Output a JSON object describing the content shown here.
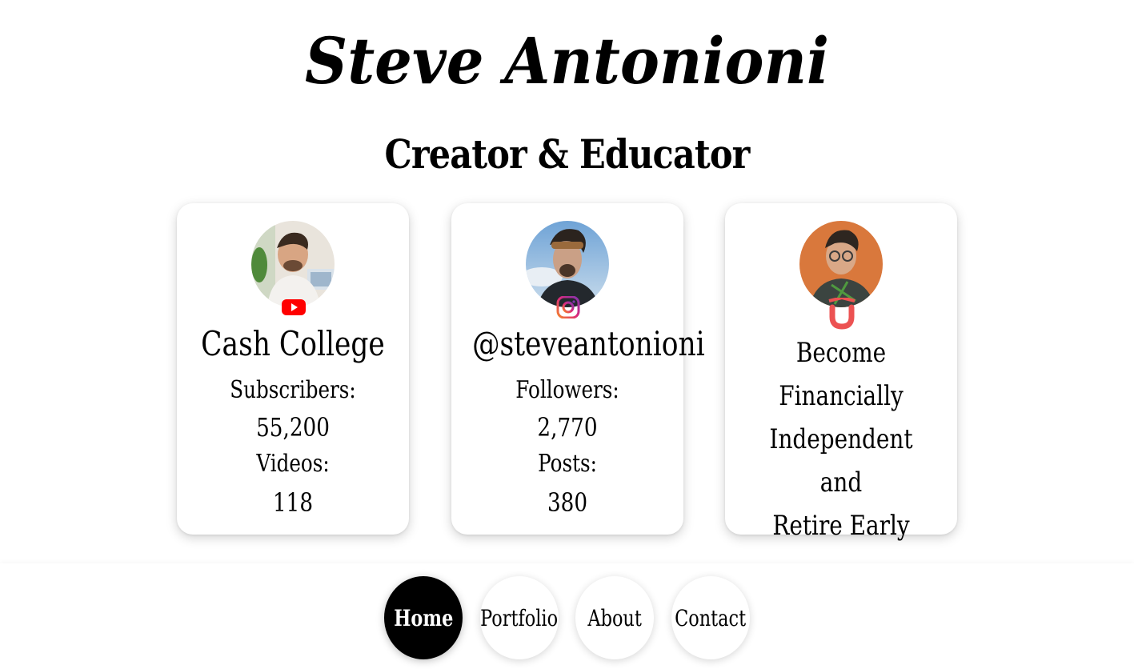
{
  "header": {
    "name": "Steve Antonioni",
    "subtitle": "Creator & Educator"
  },
  "cards": [
    {
      "platform_icon": "youtube-icon",
      "heading": "Cash College",
      "stat1_label": "Subscribers:",
      "stat1_value": "55,200",
      "stat2_label": "Videos:",
      "stat2_value": "118"
    },
    {
      "platform_icon": "instagram-icon",
      "heading": "@steveantonioni",
      "stat1_label": "Followers:",
      "stat1_value": "2,770",
      "stat2_label": "Posts:",
      "stat2_value": "380"
    },
    {
      "platform_icon": "udemy-icon",
      "tagline_line1": "Become Financially",
      "tagline_line2": "Independent and",
      "tagline_line3": "Retire Early"
    }
  ],
  "nav": {
    "items": [
      {
        "label": "Home",
        "active": true
      },
      {
        "label": "Portfolio",
        "active": false
      },
      {
        "label": "About",
        "active": false
      },
      {
        "label": "Contact",
        "active": false
      }
    ]
  },
  "colors": {
    "youtube": "#ff0000",
    "instagram_gradient_start": "#f58529",
    "instagram_gradient_end": "#8134af",
    "udemy": "#ec5252",
    "active_nav": "#000000"
  }
}
